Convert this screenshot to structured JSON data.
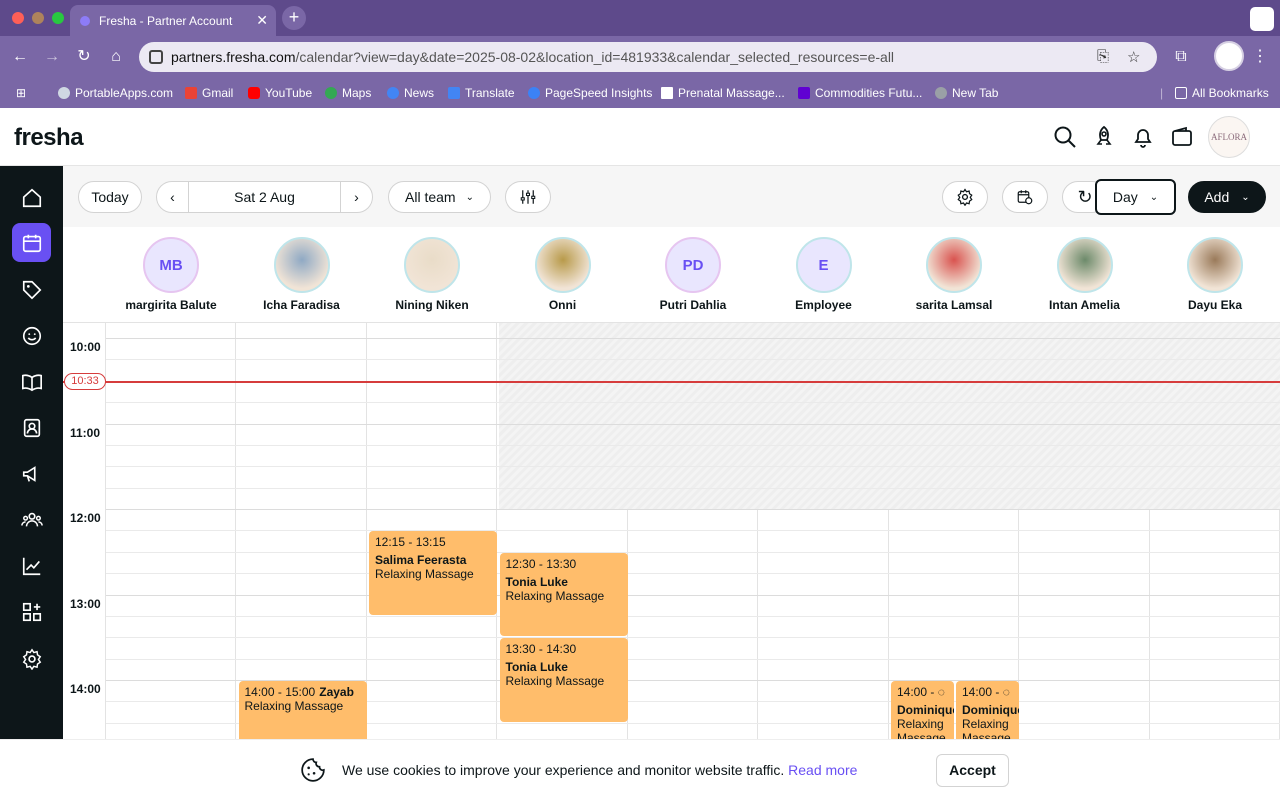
{
  "browser": {
    "tab_title": "Fresha - Partner Account",
    "url_host": "partners.fresha.com",
    "url_path": "/calendar?view=day&date=2025-08-02&location_id=481933&calendar_selected_resources=e-all",
    "bookmarks": [
      {
        "label": "PortableApps.com",
        "icon": "globe-icon"
      },
      {
        "label": "Gmail",
        "icon": "gmail-icon"
      },
      {
        "label": "YouTube",
        "icon": "youtube-icon"
      },
      {
        "label": "Maps",
        "icon": "maps-icon"
      },
      {
        "label": "News",
        "icon": "news-icon"
      },
      {
        "label": "Translate",
        "icon": "translate-icon"
      },
      {
        "label": "PageSpeed Insights",
        "icon": "pagespeed-icon"
      },
      {
        "label": "Prenatal Massage...",
        "icon": "page-icon"
      },
      {
        "label": "Commodities Futu...",
        "icon": "yahoo-icon"
      },
      {
        "label": "New Tab",
        "icon": "globe-icon"
      }
    ],
    "all_bookmarks": "All Bookmarks"
  },
  "app": {
    "logo": "fresha",
    "business_badge": "AFLORA"
  },
  "toolbar": {
    "today": "Today",
    "date": "Sat 2 Aug",
    "team": "All team",
    "view": "Day",
    "add": "Add"
  },
  "staff": [
    {
      "initials": "MB",
      "name": "margirita Balute",
      "photo": false
    },
    {
      "initials": "",
      "name": "Icha Faradisa",
      "photo": true,
      "color": "#8fa9c4"
    },
    {
      "initials": "",
      "name": "Nining Niken",
      "photo": true,
      "color": "#e9dcc8"
    },
    {
      "initials": "",
      "name": "Onni",
      "photo": true,
      "color": "#b89a4a"
    },
    {
      "initials": "PD",
      "name": "Putri Dahlia",
      "photo": false
    },
    {
      "initials": "E",
      "name": "Employee",
      "photo": false
    },
    {
      "initials": "",
      "name": "sarita Lamsal",
      "photo": true,
      "color": "#d9534f"
    },
    {
      "initials": "",
      "name": "Intan Amelia",
      "photo": true,
      "color": "#6c8a6a"
    },
    {
      "initials": "",
      "name": "Dayu Eka",
      "photo": true,
      "color": "#9a7a5a"
    }
  ],
  "times": [
    "10:00",
    "11:00",
    "12:00",
    "13:00",
    "14:00"
  ],
  "now": "10:33",
  "appointments": [
    {
      "time": "12:15 - 13:15",
      "client": "Salima Feerasta",
      "service": "Relaxing Massage"
    },
    {
      "time": "12:30 - 13:30",
      "client": "Tonia Luke",
      "service": "Relaxing Massage"
    },
    {
      "time": "13:30 - 14:30",
      "client": "Tonia Luke",
      "service": "Relaxing Massage"
    },
    {
      "time": "14:00 - 15:00",
      "client": "Zayab",
      "service": "Relaxing Massage"
    },
    {
      "time": "14:00 -",
      "client": "Dominique",
      "service": "Relaxing Massage"
    },
    {
      "time": "14:00 -",
      "client": "Dominique",
      "service": "Relaxing Massage"
    }
  ],
  "cookie": {
    "text": "We use cookies to improve your experience and monitor website traffic.",
    "link": "Read more",
    "accept": "Accept"
  },
  "colors": {
    "accent": "#6950f3",
    "appointment": "#ffbd6b",
    "now_line": "#d63c3c",
    "sidebar": "#0d1619"
  }
}
